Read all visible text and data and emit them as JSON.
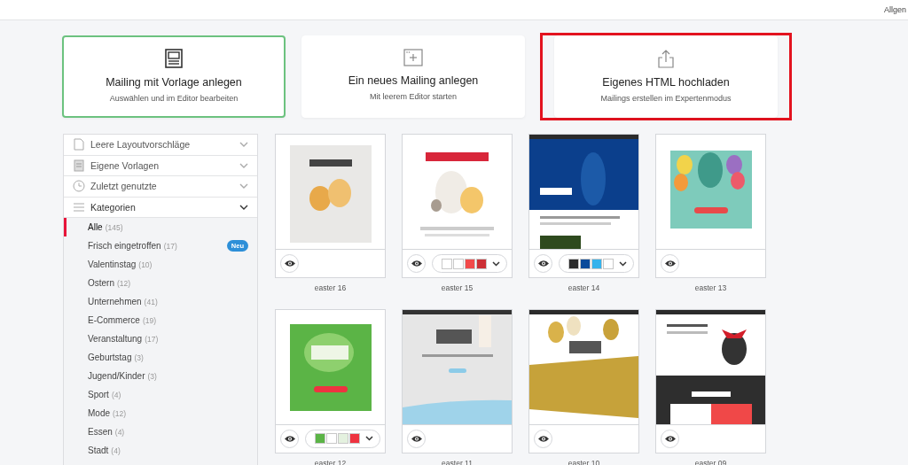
{
  "top_bar": {
    "menu_label": "Allgen"
  },
  "create_options": [
    {
      "kind": "template",
      "title": "Mailing mit Vorlage anlegen",
      "subtitle": "Auswählen und im Editor bearbeiten",
      "selected": true,
      "highlighted": false
    },
    {
      "kind": "blank",
      "title": "Ein neues Mailing anlegen",
      "subtitle": "Mit leerem Editor starten",
      "selected": false,
      "highlighted": false
    },
    {
      "kind": "upload",
      "title": "Eigenes HTML hochladen",
      "subtitle": "Mailings erstellen im Expertenmodus",
      "selected": false,
      "highlighted": true
    }
  ],
  "sidebar": {
    "sections": [
      {
        "kind": "page",
        "label": "Leere Layoutvorschläge",
        "expanded": false
      },
      {
        "kind": "template",
        "label": "Eigene Vorlagen",
        "expanded": false
      },
      {
        "kind": "clock",
        "label": "Zuletzt genutzte",
        "expanded": false
      },
      {
        "kind": "list",
        "label": "Kategorien",
        "expanded": true
      }
    ],
    "categories": [
      {
        "name": "Alle",
        "count": "(145)",
        "selected": true
      },
      {
        "name": "Frisch eingetroffen",
        "count": "(17)",
        "selected": false,
        "badge": "Neu"
      },
      {
        "name": "Valentinstag",
        "count": "(10)",
        "selected": false
      },
      {
        "name": "Ostern",
        "count": "(12)",
        "selected": false
      },
      {
        "name": "Unternehmen",
        "count": "(41)",
        "selected": false
      },
      {
        "name": "E-Commerce",
        "count": "(19)",
        "selected": false
      },
      {
        "name": "Veranstaltung",
        "count": "(17)",
        "selected": false
      },
      {
        "name": "Geburtstag",
        "count": "(3)",
        "selected": false
      },
      {
        "name": "Jugend/Kinder",
        "count": "(3)",
        "selected": false
      },
      {
        "name": "Sport",
        "count": "(4)",
        "selected": false
      },
      {
        "name": "Mode",
        "count": "(12)",
        "selected": false
      },
      {
        "name": "Essen",
        "count": "(4)",
        "selected": false
      },
      {
        "name": "Stadt",
        "count": "(4)",
        "selected": false
      }
    ]
  },
  "templates": [
    {
      "name": "easter 16"
    },
    {
      "name": "easter 15",
      "swatches": [
        {
          "color": "#ffffff"
        },
        {
          "color": "#ffffff"
        },
        {
          "color": "#f24a4a"
        },
        {
          "color": "#cc3036"
        }
      ]
    },
    {
      "name": "easter 14",
      "swatches": [
        {
          "color": "#2b2b2b"
        },
        {
          "color": "#0b4a9a"
        },
        {
          "color": "#35b3ec"
        },
        {
          "color": "#ffffff"
        }
      ]
    },
    {
      "name": "easter 13"
    },
    {
      "name": "easter 12",
      "swatches": [
        {
          "color": "#5bb446"
        },
        {
          "color": "#ffffff"
        },
        {
          "color": "#e4f1df"
        },
        {
          "color": "#ee3340"
        }
      ]
    },
    {
      "name": "easter 11"
    },
    {
      "name": "easter 10"
    },
    {
      "name": "easter 09"
    }
  ]
}
